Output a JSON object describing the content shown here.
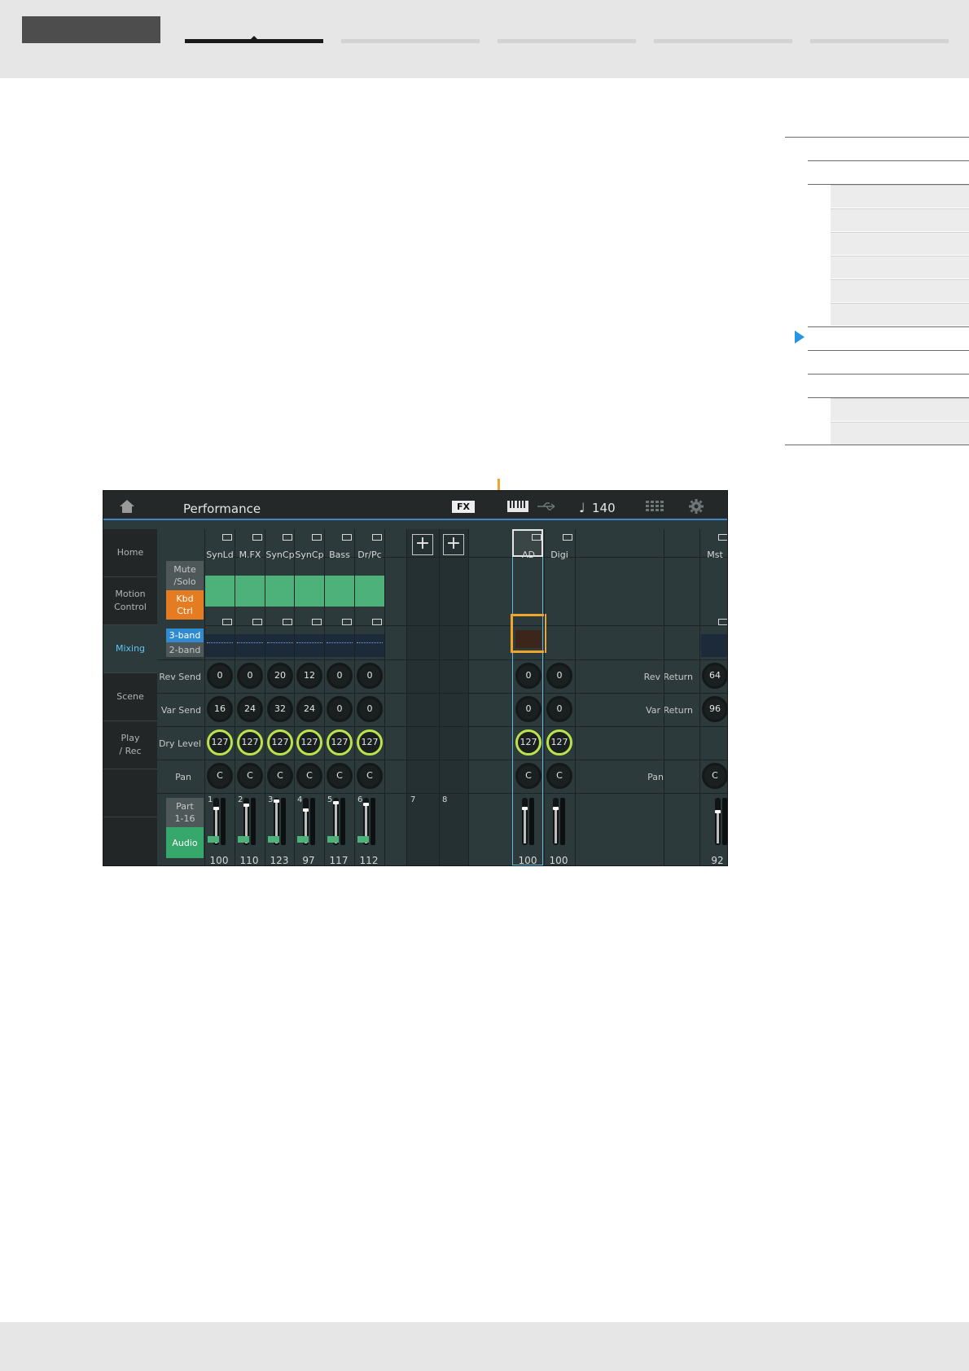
{
  "screen": {
    "title": "Performance",
    "fx_badge": "FX",
    "tempo": "140",
    "note_glyph": "♩",
    "sidebar": [
      {
        "label": "Home"
      },
      {
        "label": "Motion\nControl"
      },
      {
        "label": "Mixing",
        "active": true
      },
      {
        "label": "Scene"
      },
      {
        "label": "Play\n/ Rec"
      }
    ],
    "buttons": {
      "mute_solo": "Mute\n/Solo",
      "kbd_ctrl": "Kbd\nCtrl",
      "eq_3band": "3-band",
      "eq_2band": "2-band",
      "part_range": "Part\n1-16",
      "audio": "Audio"
    },
    "row_labels": {
      "rev_send": "Rev Send",
      "var_send": "Var Send",
      "dry_level": "Dry Level",
      "pan": "Pan",
      "rev_return": "Rev Return",
      "var_return": "Var Return",
      "master_pan": "Pan"
    },
    "parts": [
      {
        "num": "1",
        "name": "SynLd",
        "rev": "0",
        "var": "16",
        "dry": "127",
        "pan": "C",
        "volume": "100"
      },
      {
        "num": "2",
        "name": "M.FX",
        "rev": "0",
        "var": "24",
        "dry": "127",
        "pan": "C",
        "volume": "110"
      },
      {
        "num": "3",
        "name": "SynCp",
        "rev": "20",
        "var": "32",
        "dry": "127",
        "pan": "C",
        "volume": "123"
      },
      {
        "num": "4",
        "name": "SynCp",
        "rev": "12",
        "var": "24",
        "dry": "127",
        "pan": "C",
        "volume": "97"
      },
      {
        "num": "5",
        "name": "Bass",
        "rev": "0",
        "var": "0",
        "dry": "127",
        "pan": "C",
        "volume": "117"
      },
      {
        "num": "6",
        "name": "Dr/Pc",
        "rev": "0",
        "var": "0",
        "dry": "127",
        "pan": "C",
        "volume": "112"
      }
    ],
    "empty_parts": [
      "7",
      "8"
    ],
    "plus_glyph": "+",
    "audio_parts": [
      {
        "name": "AD",
        "rev": "0",
        "var": "0",
        "dry": "127",
        "pan": "C",
        "volume": "100"
      },
      {
        "name": "Digi",
        "rev": "0",
        "var": "0",
        "dry": "127",
        "pan": "C",
        "volume": "100"
      }
    ],
    "master": {
      "name": "Mst",
      "rev_return": "64",
      "var_return": "96",
      "pan": "C",
      "volume": "92"
    }
  },
  "colors": {
    "accent_orange": "#f0a52c",
    "pointer_blue": "#2596e6",
    "active_tab": "#5ec6f2",
    "dry_ring": "#bde34a",
    "kbd_green": "#4cb27a"
  }
}
